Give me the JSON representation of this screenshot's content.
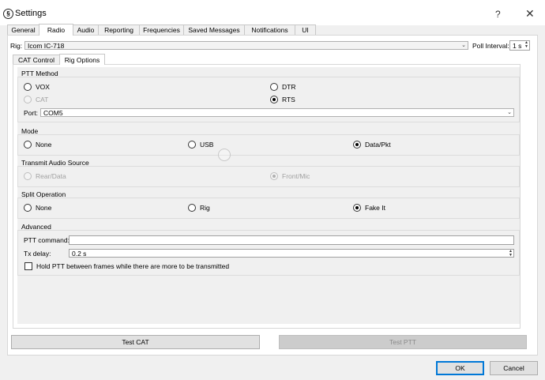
{
  "window": {
    "title": "Settings",
    "help": "?",
    "close": "✕",
    "icon_glyph": "§"
  },
  "tabs": [
    {
      "label": "General"
    },
    {
      "label": "Radio"
    },
    {
      "label": "Audio"
    },
    {
      "label": "Reporting"
    },
    {
      "label": "Frequencies"
    },
    {
      "label": "Saved Messages"
    },
    {
      "label": "Notifications"
    },
    {
      "label": "UI"
    }
  ],
  "rig": {
    "label": "Rig:",
    "value": "Icom IC-718"
  },
  "poll": {
    "label": "Poll Interval:",
    "value": "1 s"
  },
  "inner_tabs": [
    {
      "label": "CAT Control"
    },
    {
      "label": "Rig Options"
    }
  ],
  "ptt_method": {
    "title": "PTT Method",
    "vox": "VOX",
    "dtr": "DTR",
    "cat": "CAT",
    "rts": "RTS",
    "port_label": "Port:",
    "port_value": "COM5"
  },
  "mode": {
    "title": "Mode",
    "none": "None",
    "usb": "USB",
    "data": "Data/Pkt"
  },
  "tx_audio": {
    "title": "Transmit Audio Source",
    "rear": "Rear/Data",
    "front": "Front/Mic"
  },
  "split": {
    "title": "Split Operation",
    "none": "None",
    "rig": "Rig",
    "fake": "Fake It"
  },
  "advanced": {
    "title": "Advanced",
    "ptt_cmd_label": "PTT command:",
    "ptt_cmd_value": "",
    "tx_delay_label": "Tx delay:",
    "tx_delay_value": "0.2  s",
    "hold_ptt_label": "Hold PTT between frames while there are more to be transmitted"
  },
  "buttons": {
    "test_cat": "Test CAT",
    "test_ptt": "Test PTT",
    "ok": "OK",
    "cancel": "Cancel"
  },
  "arrows": {
    "down": "⌄",
    "spin_up": "▲",
    "spin_down": "▼"
  }
}
